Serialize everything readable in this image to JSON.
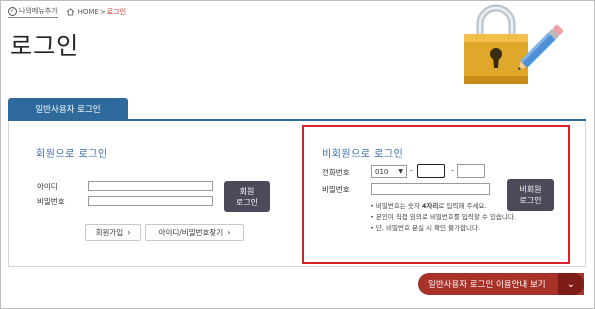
{
  "topbar": {
    "my_menu_label": "나의메뉴추가",
    "breadcrumb": {
      "home": "HOME",
      "separator": ">",
      "current": "로그인"
    }
  },
  "page_title": "로그인",
  "tab": {
    "label": "일반사용자 로그인"
  },
  "member": {
    "title": "회원으로 로그인",
    "id_label": "아이디",
    "id_value": "",
    "password_label": "비밀번호",
    "password_value": "",
    "login_button_line1": "회원",
    "login_button_line2": "로그인",
    "join_label": "회원가입",
    "find_label": "아이디/비밀번호찾기",
    "arrow": "›"
  },
  "nonmember": {
    "title": "비회원으로 로그인",
    "phone_label": "전화번호",
    "phone_prefix_selected": "010",
    "phone_separator": "-",
    "phone_mid_value": "",
    "phone_last_value": "",
    "password_label": "비밀번호",
    "password_value": "",
    "login_button_line1": "비회원",
    "login_button_line2": "로그인",
    "note1_before": "• 비밀번호는 숫자 ",
    "note1_bold": "4자리",
    "note1_after": "로 입력해 주세요.",
    "note2": "• 본인이 직접 임의로 비밀번호를 입력할 수 있습니다.",
    "note3": "• 단, 비밀번호 분실 시 확인 불가합니다."
  },
  "guide": {
    "label": "일반사용자 로그인 이용안내 보기",
    "chevron": "⌄"
  },
  "colors": {
    "tab_blue": "#2f6a9d",
    "highlight_red": "#d9232a",
    "guide_red": "#a8322a",
    "button_dark": "#4a4a5a",
    "title_blue": "#3b6ea5"
  }
}
